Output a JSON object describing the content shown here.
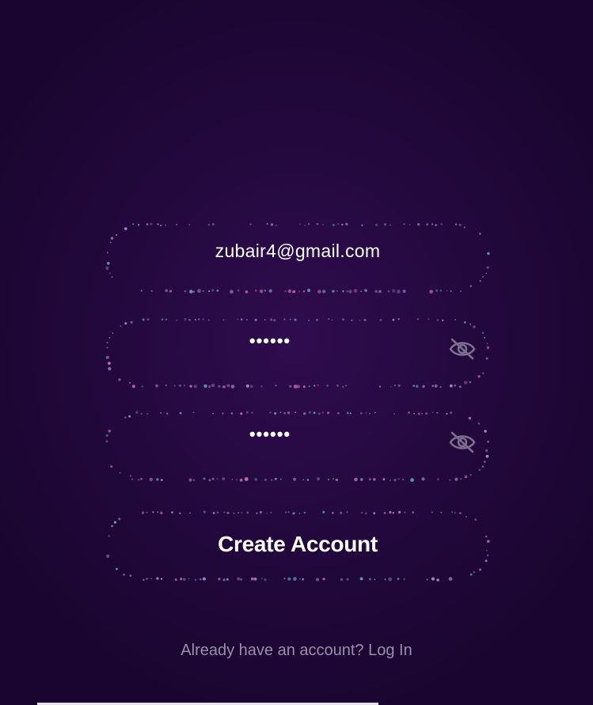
{
  "form": {
    "email_value": "zubair4@gmail.com",
    "password_value": "••••••",
    "confirm_password_value": "••••••",
    "create_button_label": "Create Account",
    "login_prompt": "Already have an account? Log In"
  },
  "icons": {
    "password_toggle": "eye-off-icon",
    "confirm_password_toggle": "eye-off-icon"
  },
  "colors": {
    "background": "#24093f",
    "dot_pink": "#c86aa8",
    "dot_teal": "#5fa0c0",
    "dot_violet": "#a58ad0",
    "link_text": "#9a8fa8"
  }
}
